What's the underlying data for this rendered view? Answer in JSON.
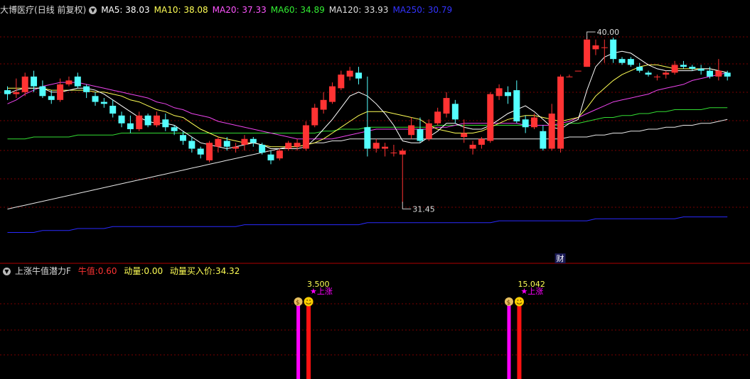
{
  "main_panel": {
    "stock_name": "大博医疗",
    "period_label": "(日线 前复权)",
    "ma_legend": [
      {
        "label": "MA5: 38.03",
        "color": "#ffffff"
      },
      {
        "label": "MA10: 38.08",
        "color": "#ffff55"
      },
      {
        "label": "MA20: 37.33",
        "color": "#ff55ff"
      },
      {
        "label": "MA60: 34.89",
        "color": "#33ee33"
      },
      {
        "label": "MA120: 33.93",
        "color": "#dddddd"
      },
      {
        "label": "MA250: 30.79",
        "color": "#3333ff"
      }
    ],
    "high_label": "40.00",
    "low_label": "31.45",
    "finance_marker": "财"
  },
  "indicator_panel": {
    "name": "上涨牛值潜力F",
    "niu_label": "牛值:",
    "niu_value": "0.60",
    "dongliang_label": "动量:",
    "dongliang_value": "0.00",
    "buy_label": "动量买入价:",
    "buy_value": "34.32",
    "signals": [
      {
        "value": "3.500",
        "tag": "★上涨"
      },
      {
        "value": "15.042",
        "tag": "★上涨"
      }
    ]
  },
  "colors": {
    "up": "#ff3333",
    "down": "#54ffff",
    "grid": "#7a0000",
    "magenta": "#ff00ff"
  },
  "chart_data": {
    "type": "candlestick",
    "ylim": [
      29.0,
      41.2
    ],
    "ohlc": [
      [
        37.3,
        37.5,
        36.8,
        37.1
      ],
      [
        37.1,
        37.9,
        36.9,
        37.2
      ],
      [
        37.2,
        38.2,
        37.0,
        38.0
      ],
      [
        38.0,
        38.3,
        37.2,
        37.5
      ],
      [
        37.5,
        37.8,
        36.9,
        37.0
      ],
      [
        37.0,
        37.3,
        36.6,
        36.8
      ],
      [
        36.8,
        37.9,
        36.7,
        37.6
      ],
      [
        37.6,
        38.0,
        37.5,
        37.8
      ],
      [
        38.0,
        38.2,
        37.4,
        37.5
      ],
      [
        37.5,
        37.6,
        36.9,
        37.2
      ],
      [
        37.0,
        37.2,
        36.5,
        36.7
      ],
      [
        36.7,
        36.9,
        36.4,
        36.6
      ],
      [
        36.5,
        36.8,
        35.9,
        36.1
      ],
      [
        36.0,
        36.2,
        35.4,
        35.6
      ],
      [
        35.6,
        36.0,
        35.1,
        35.3
      ],
      [
        35.3,
        36.2,
        35.2,
        36.0
      ],
      [
        36.0,
        36.1,
        35.4,
        35.5
      ],
      [
        35.5,
        36.2,
        35.4,
        36.0
      ],
      [
        35.8,
        36.1,
        35.2,
        35.4
      ],
      [
        35.4,
        35.5,
        35.0,
        35.2
      ],
      [
        35.0,
        35.2,
        34.5,
        34.7
      ],
      [
        34.7,
        34.9,
        34.1,
        34.3
      ],
      [
        34.3,
        34.4,
        33.8,
        34.0
      ],
      [
        33.7,
        34.7,
        33.6,
        34.6
      ],
      [
        34.4,
        34.9,
        34.1,
        34.8
      ],
      [
        34.7,
        34.9,
        34.2,
        34.4
      ],
      [
        34.3,
        34.6,
        34.1,
        34.4
      ],
      [
        34.5,
        35.0,
        34.2,
        34.8
      ],
      [
        34.8,
        34.9,
        34.4,
        34.6
      ],
      [
        34.5,
        34.6,
        34.0,
        34.1
      ],
      [
        34.0,
        34.2,
        33.5,
        33.7
      ],
      [
        33.8,
        34.3,
        33.7,
        34.2
      ],
      [
        34.3,
        34.7,
        34.2,
        34.6
      ],
      [
        34.4,
        34.8,
        34.2,
        34.6
      ],
      [
        34.3,
        35.7,
        34.2,
        35.5
      ],
      [
        35.5,
        36.6,
        35.4,
        36.4
      ],
      [
        36.3,
        37.2,
        36.1,
        36.8
      ],
      [
        36.7,
        37.7,
        36.6,
        37.5
      ],
      [
        37.4,
        38.3,
        37.3,
        38.1
      ],
      [
        38.0,
        38.5,
        37.8,
        38.3
      ],
      [
        38.2,
        38.5,
        37.6,
        37.9
      ],
      [
        35.4,
        38.0,
        33.9,
        34.3
      ],
      [
        34.3,
        34.8,
        34.1,
        34.6
      ],
      [
        34.3,
        34.6,
        33.9,
        34.4
      ],
      [
        34.1,
        34.5,
        33.9,
        34.1
      ],
      [
        34.0,
        34.3,
        31.5,
        34.2
      ],
      [
        35.0,
        35.9,
        34.8,
        35.5
      ],
      [
        35.3,
        35.9,
        34.6,
        34.7
      ],
      [
        34.8,
        35.8,
        34.7,
        35.6
      ],
      [
        35.6,
        36.4,
        35.5,
        36.2
      ],
      [
        36.1,
        37.2,
        35.9,
        36.9
      ],
      [
        36.6,
        36.8,
        35.6,
        35.8
      ],
      [
        34.9,
        35.8,
        34.6,
        35.1
      ],
      [
        34.3,
        34.7,
        34.0,
        34.5
      ],
      [
        34.5,
        34.9,
        34.3,
        34.8
      ],
      [
        34.7,
        37.2,
        34.6,
        37.1
      ],
      [
        37.0,
        37.6,
        36.8,
        37.4
      ],
      [
        37.2,
        37.5,
        36.6,
        37.0
      ],
      [
        37.3,
        37.8,
        35.6,
        35.7
      ],
      [
        35.8,
        36.0,
        35.1,
        35.4
      ],
      [
        35.4,
        36.1,
        35.3,
        35.9
      ],
      [
        35.2,
        35.5,
        34.2,
        34.3
      ],
      [
        34.3,
        36.6,
        34.2,
        36.1
      ],
      [
        34.3,
        38.1,
        34.1,
        38.0
      ],
      [
        38.0,
        38.1,
        38.0,
        38.0
      ],
      [
        38.3,
        38.3,
        38.3,
        38.3
      ],
      [
        38.5,
        40.0,
        38.5,
        39.9
      ],
      [
        39.4,
        39.9,
        39.1,
        39.6
      ],
      [
        39.5,
        39.9,
        38.7,
        39.5
      ],
      [
        39.9,
        40.0,
        38.7,
        38.9
      ],
      [
        38.9,
        39.0,
        38.6,
        38.7
      ],
      [
        38.9,
        39.0,
        38.5,
        38.6
      ],
      [
        38.5,
        38.7,
        38.2,
        38.3
      ],
      [
        38.2,
        38.3,
        38.0,
        38.1
      ],
      [
        38.0,
        38.1,
        37.8,
        38.0
      ],
      [
        38.1,
        38.3,
        37.9,
        38.2
      ],
      [
        38.2,
        38.8,
        38.1,
        38.6
      ],
      [
        38.6,
        38.8,
        38.4,
        38.5
      ],
      [
        38.5,
        38.6,
        38.3,
        38.4
      ],
      [
        38.4,
        38.6,
        38.1,
        38.3
      ],
      [
        38.3,
        38.5,
        37.9,
        38.0
      ],
      [
        38.0,
        38.9,
        37.8,
        38.3
      ],
      [
        38.2,
        38.3,
        37.8,
        38.0
      ]
    ],
    "ma5": [
      37.1,
      37.3,
      37.4,
      37.4,
      37.4,
      37.2,
      37.2,
      37.3,
      37.4,
      37.4,
      37.3,
      37.1,
      36.8,
      36.5,
      36.2,
      35.9,
      35.7,
      35.6,
      35.6,
      35.5,
      35.2,
      34.9,
      34.6,
      34.5,
      34.4,
      34.3,
      34.4,
      34.5,
      34.6,
      34.5,
      34.3,
      34.3,
      34.3,
      34.3,
      34.4,
      34.8,
      35.3,
      35.8,
      36.4,
      37.0,
      37.2,
      37.0,
      36.6,
      36.1,
      35.5,
      34.7,
      34.6,
      34.6,
      34.9,
      35.2,
      35.6,
      35.6,
      35.4,
      35.3,
      35.3,
      35.5,
      35.8,
      36.1,
      36.3,
      36.5,
      36.2,
      35.8,
      35.4,
      35.3,
      35.6,
      35.8,
      37.3,
      38.5,
      39.0,
      39.2,
      39.3,
      39.2,
      38.9,
      38.6,
      38.4,
      38.3,
      38.3,
      38.3,
      38.3,
      38.4,
      38.4,
      38.3,
      38.2
    ],
    "ma10": [
      37.4,
      37.4,
      37.4,
      37.4,
      37.4,
      37.3,
      37.3,
      37.3,
      37.3,
      37.3,
      37.2,
      37.2,
      37.1,
      37.0,
      36.8,
      36.7,
      36.5,
      36.3,
      36.2,
      36.0,
      35.9,
      35.6,
      35.3,
      35.1,
      34.9,
      34.8,
      34.7,
      34.6,
      34.6,
      34.5,
      34.4,
      34.4,
      34.4,
      34.4,
      34.5,
      34.6,
      34.8,
      35.1,
      35.4,
      35.7,
      36.0,
      36.2,
      36.2,
      36.2,
      36.1,
      36.0,
      35.9,
      35.8,
      35.5,
      35.3,
      35.2,
      35.1,
      35.1,
      35.1,
      35.2,
      35.4,
      35.6,
      35.8,
      35.9,
      36.0,
      36.0,
      35.9,
      35.8,
      35.7,
      35.8,
      35.9,
      36.4,
      37.0,
      37.4,
      37.8,
      38.1,
      38.3,
      38.5,
      38.6,
      38.6,
      38.5,
      38.4,
      38.4,
      38.4,
      38.4,
      38.4,
      38.3,
      38.2
    ],
    "ma20": [
      36.6,
      36.8,
      37.1,
      37.3,
      37.5,
      37.6,
      37.7,
      37.7,
      37.7,
      37.6,
      37.5,
      37.4,
      37.3,
      37.2,
      37.1,
      37.0,
      36.9,
      36.7,
      36.6,
      36.4,
      36.3,
      36.1,
      36.0,
      35.9,
      35.7,
      35.6,
      35.5,
      35.4,
      35.3,
      35.2,
      35.1,
      35.0,
      34.9,
      34.8,
      34.8,
      34.8,
      34.8,
      34.8,
      34.9,
      35.0,
      35.1,
      35.2,
      35.3,
      35.3,
      35.3,
      35.3,
      35.3,
      35.3,
      35.3,
      35.4,
      35.4,
      35.5,
      35.6,
      35.6,
      35.6,
      35.6,
      35.6,
      35.6,
      35.6,
      35.5,
      35.5,
      35.5,
      35.5,
      35.6,
      35.7,
      35.9,
      36.1,
      36.3,
      36.5,
      36.7,
      36.8,
      36.9,
      37.0,
      37.1,
      37.3,
      37.4,
      37.5,
      37.6,
      37.8,
      37.9,
      38.0,
      38.1,
      38.2
    ],
    "ma60": [
      34.8,
      34.8,
      34.8,
      34.9,
      34.9,
      34.9,
      34.9,
      34.9,
      35.0,
      35.0,
      35.0,
      35.0,
      35.0,
      35.1,
      35.1,
      35.1,
      35.1,
      35.1,
      35.1,
      35.1,
      35.1,
      35.1,
      35.1,
      35.1,
      35.1,
      35.1,
      35.1,
      35.1,
      35.1,
      35.1,
      35.1,
      35.1,
      35.1,
      35.1,
      35.1,
      35.1,
      35.2,
      35.2,
      35.3,
      35.3,
      35.3,
      35.4,
      35.4,
      35.4,
      35.4,
      35.4,
      35.4,
      35.4,
      35.4,
      35.5,
      35.5,
      35.5,
      35.5,
      35.5,
      35.5,
      35.5,
      35.5,
      35.5,
      35.5,
      35.5,
      35.5,
      35.5,
      35.5,
      35.5,
      35.6,
      35.6,
      35.7,
      35.8,
      35.9,
      35.9,
      36.0,
      36.0,
      36.1,
      36.1,
      36.2,
      36.2,
      36.3,
      36.3,
      36.3,
      36.3,
      36.4,
      36.4,
      36.4
    ],
    "ma120": [
      31.2,
      31.3,
      31.4,
      31.5,
      31.6,
      31.7,
      31.8,
      31.9,
      32.0,
      32.1,
      32.2,
      32.3,
      32.4,
      32.5,
      32.6,
      32.7,
      32.8,
      32.9,
      33.0,
      33.1,
      33.2,
      33.3,
      33.4,
      33.5,
      33.6,
      33.7,
      33.8,
      33.9,
      34.0,
      34.1,
      34.2,
      34.3,
      34.4,
      34.4,
      34.5,
      34.6,
      34.6,
      34.7,
      34.7,
      34.8,
      34.8,
      34.8,
      34.8,
      34.8,
      34.8,
      34.8,
      34.8,
      34.8,
      34.8,
      34.8,
      34.8,
      34.8,
      34.8,
      34.8,
      34.8,
      34.8,
      34.8,
      34.8,
      34.8,
      34.8,
      34.8,
      34.8,
      34.8,
      34.8,
      34.9,
      34.9,
      34.9,
      35.0,
      35.0,
      35.1,
      35.1,
      35.2,
      35.2,
      35.3,
      35.3,
      35.4,
      35.4,
      35.5,
      35.5,
      35.6,
      35.6,
      35.7,
      35.8
    ],
    "ma250": [
      30.0,
      30.0,
      30.0,
      30.0,
      30.1,
      30.1,
      30.1,
      30.1,
      30.2,
      30.2,
      30.2,
      30.2,
      30.3,
      30.3,
      30.3,
      30.3,
      30.3,
      30.3,
      30.3,
      30.3,
      30.3,
      30.3,
      30.3,
      30.3,
      30.3,
      30.3,
      30.3,
      30.4,
      30.4,
      30.4,
      30.4,
      30.4,
      30.4,
      30.4,
      30.4,
      30.4,
      30.4,
      30.4,
      30.4,
      30.4,
      30.4,
      30.5,
      30.5,
      30.5,
      30.5,
      30.5,
      30.5,
      30.5,
      30.5,
      30.5,
      30.5,
      30.5,
      30.5,
      30.5,
      30.5,
      30.5,
      30.6,
      30.6,
      30.6,
      30.6,
      30.6,
      30.6,
      30.6,
      30.6,
      30.6,
      30.6,
      30.6,
      30.7,
      30.7,
      30.7,
      30.7,
      30.7,
      30.7,
      30.7,
      30.7,
      30.7,
      30.7,
      30.8,
      30.8,
      30.8,
      30.8,
      30.8,
      30.8
    ],
    "signals": [
      {
        "index": 33,
        "value": 3.5,
        "tag": "★上涨"
      },
      {
        "index": 57,
        "value": 15.042,
        "tag": "★上涨"
      }
    ]
  }
}
